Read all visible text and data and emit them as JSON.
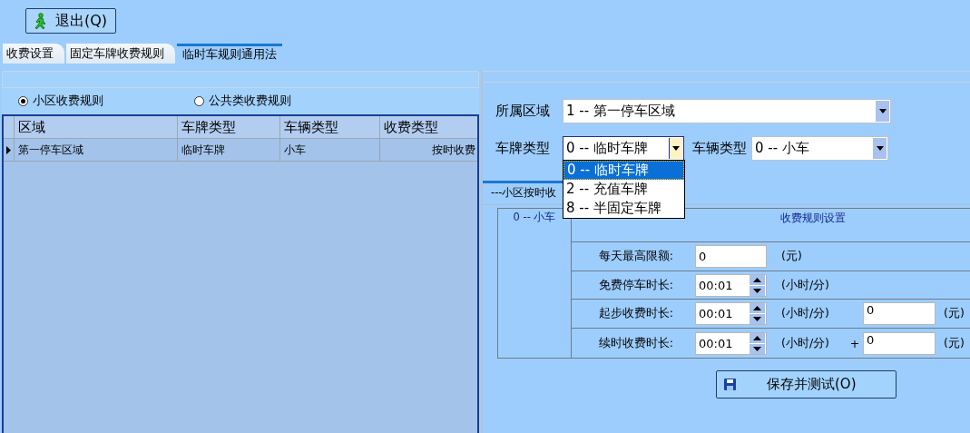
{
  "exit_button": {
    "label": "退出(Q)"
  },
  "tabs": [
    {
      "label": "收费设置",
      "selected": false
    },
    {
      "label": "固定车牌收费规则",
      "selected": false
    },
    {
      "label": "临时车规则通用法",
      "selected": true
    }
  ],
  "rule_type_options": [
    {
      "label": "小区收费规则",
      "selected": true
    },
    {
      "label": "公共类收费规则",
      "selected": false
    }
  ],
  "grid": {
    "columns": [
      "区域",
      "车牌类型",
      "车辆类型",
      "收费类型"
    ],
    "rows": [
      {
        "cells": [
          "第一停车区域",
          "临时车牌",
          "小车",
          "按时收费"
        ],
        "current": true
      }
    ]
  },
  "form": {
    "area": {
      "label": "所属区域",
      "value": "1 -- 第一停车区域"
    },
    "plate_type": {
      "label": "车牌类型",
      "value": "0 -- 临时车牌",
      "expanded": true,
      "options": [
        {
          "label": "0 -- 临时车牌",
          "selected": true
        },
        {
          "label": "2 -- 充值车牌",
          "selected": false
        },
        {
          "label": "8 -- 半固定车牌",
          "selected": false
        }
      ]
    },
    "vehicle_type": {
      "label": "车辆类型",
      "value": "0 -- 小车"
    }
  },
  "rule_tab": {
    "label": "---小区按时收"
  },
  "rule_table": {
    "vehicle": "0 -- 小车",
    "header": "收费规则设置",
    "rows": [
      {
        "kind": "amount",
        "label": "每天最高限额:",
        "value": "0",
        "unit": "(元)"
      },
      {
        "kind": "duration",
        "label": "免费停车时长:",
        "value": "00:01",
        "unit": "(小时/分)"
      },
      {
        "kind": "duration",
        "label": "起步收费时长:",
        "value": "00:01",
        "unit": "(小时/分)",
        "extra_value": "0",
        "extra_unit": "(元)"
      },
      {
        "kind": "duration",
        "label": "续时收费时长:",
        "value": "00:01",
        "unit": "(小时/分)",
        "extra_prefix": "+",
        "extra_value": "0",
        "extra_unit": "(元)"
      }
    ]
  },
  "save_button": {
    "label": "保存并测试(O)"
  }
}
